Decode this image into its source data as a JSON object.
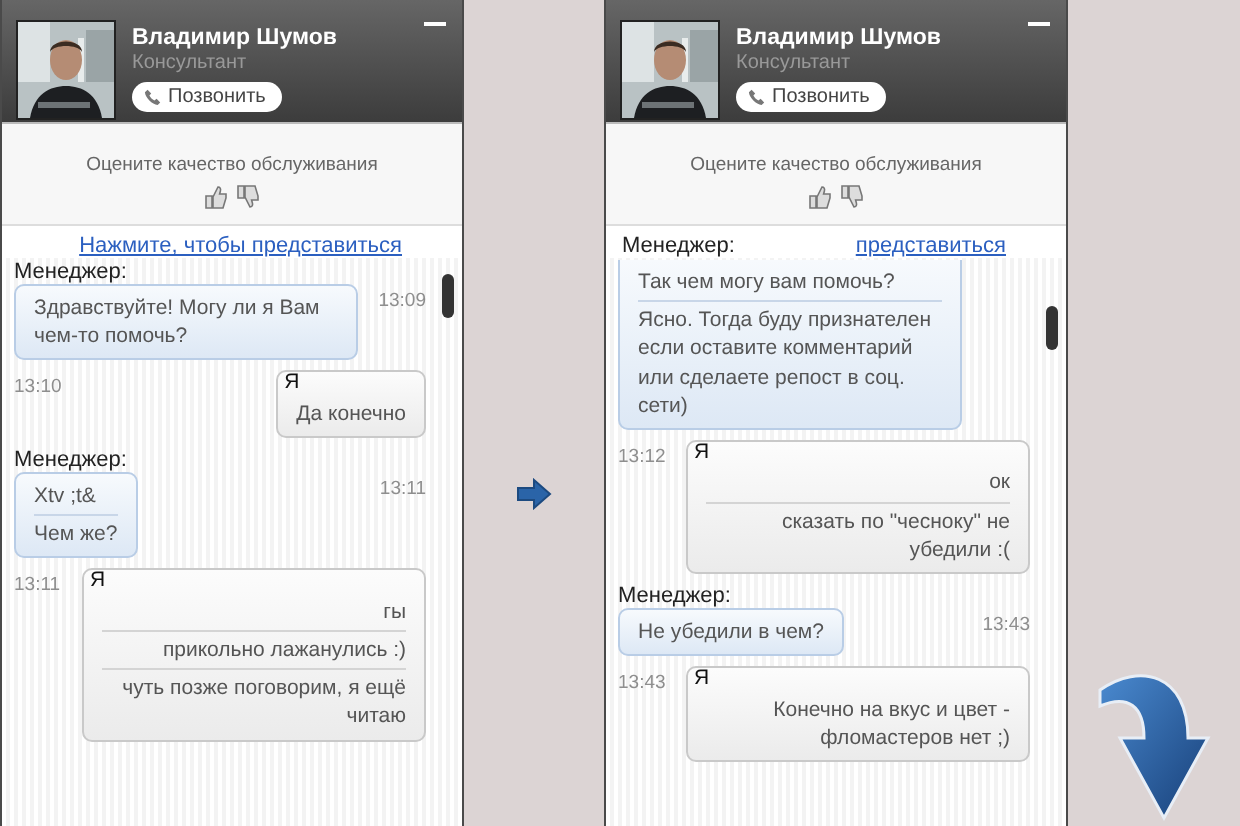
{
  "panels": [
    {
      "header": {
        "name": "Владимир Шумов",
        "role": "Консультант",
        "call_button": "Позвонить"
      },
      "rating": {
        "prompt": "Оцените качество обслуживания"
      },
      "intro": {
        "link": "Нажмите, чтобы представиться"
      },
      "messages": [
        {
          "kind": "manager",
          "sender": "Менеджер:",
          "time": "13:09",
          "parts": [
            "Здравствуйте! Могу ли я Вам чем-то помочь?"
          ]
        },
        {
          "kind": "me",
          "sender": "Я",
          "time": "13:10",
          "parts": [
            "Да конечно"
          ]
        },
        {
          "kind": "manager",
          "sender": "Менеджер:",
          "time": "13:11",
          "parts": [
            "Xtv ;t&",
            "Чем же?"
          ]
        },
        {
          "kind": "me",
          "sender": "Я",
          "time": "13:11",
          "parts": [
            "гы",
            "прикольно лажанулись :)",
            "чуть позже поговорим, я ещё читаю"
          ]
        }
      ]
    },
    {
      "header": {
        "name": "Владимир Шумов",
        "role": "Консультант",
        "call_button": "Позвонить"
      },
      "rating": {
        "prompt": "Оцените качество обслуживания"
      },
      "intro": {
        "sender": "Менеджер:",
        "link": "представиться"
      },
      "messages": [
        {
          "kind": "manager",
          "cut_top": true,
          "parts": [
            "Так чем могу вам помочь?",
            "Ясно. Тогда буду признателен если оставите комментарий или сделаете репост в соц. сети)"
          ]
        },
        {
          "kind": "me",
          "sender": "Я",
          "time": "13:12",
          "parts": [
            "ок",
            "сказать по \"чесноку\" не убедили :("
          ]
        },
        {
          "kind": "manager",
          "sender": "Менеджер:",
          "time": "13:43",
          "parts": [
            "Не убедили в чем?"
          ]
        },
        {
          "kind": "me",
          "sender": "Я",
          "time": "13:43",
          "parts": [
            "Конечно на вкус и цвет - фломастеров нет ;)"
          ]
        }
      ]
    }
  ]
}
